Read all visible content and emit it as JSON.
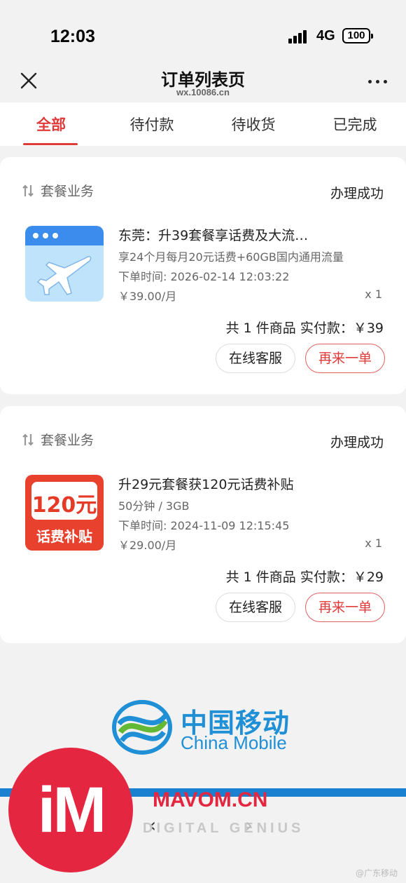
{
  "status_bar": {
    "time": "12:03",
    "network": "4G",
    "battery": "100"
  },
  "nav": {
    "title": "订单列表页",
    "subtitle": "wx.10086.cn"
  },
  "tabs": [
    {
      "label": "全部"
    },
    {
      "label": "待付款"
    },
    {
      "label": "待收货"
    },
    {
      "label": "已完成"
    }
  ],
  "orders": [
    {
      "category": "套餐业务",
      "status": "办理成功",
      "image_icon": "airplane-icon",
      "title": "东莞：升39套餐享话费及大流…",
      "desc": "享24个月每月20元话费+60GB国内通用流量",
      "time": "下单时间: 2026-02-14 12:03:22",
      "price": "￥39.00/月",
      "qty": "x 1",
      "summary": "共 1 件商品  实付款：￥39",
      "btn_service": "在线客服",
      "btn_again": "再来一单"
    },
    {
      "category": "套餐业务",
      "status": "办理成功",
      "image_icon": "subsidy-coupon-icon",
      "image_amount": "120元",
      "image_caption": "话费补贴",
      "title": "升29元套餐获120元话费补贴",
      "desc": "50分钟 / 3GB",
      "time": "下单时间: 2024-11-09 12:15:45",
      "price": "￥29.00/月",
      "qty": "x 1",
      "summary": "共 1 件商品  实付款：￥29",
      "btn_service": "在线客服",
      "btn_again": "再来一单"
    }
  ],
  "footer": {
    "brand_cn": "中国移动",
    "brand_en": "China Mobile",
    "watermark_badge": "iM",
    "watermark_site": "MAVOM.CN",
    "watermark_tagline": "DIGITAL GENIUS",
    "credit": "@广东移动"
  },
  "colors": {
    "accent": "#e03a3a",
    "brand_blue": "#1f8fd6",
    "background": "#f2f2f2"
  }
}
